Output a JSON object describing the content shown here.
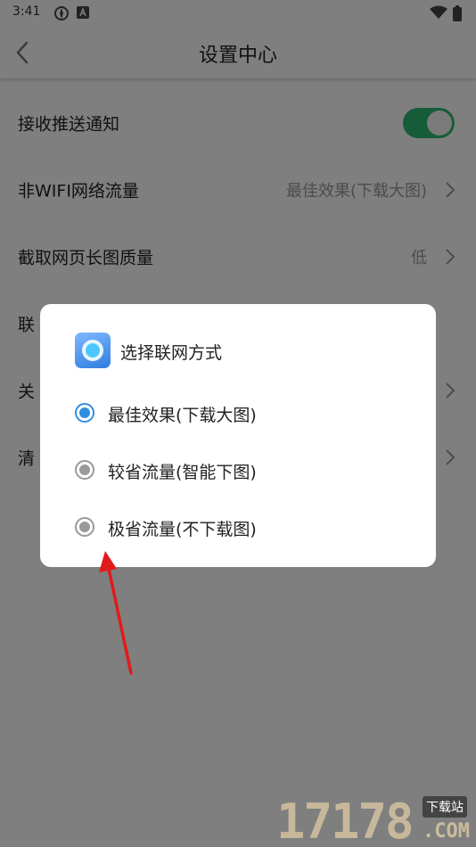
{
  "status_bar": {
    "time": "3:41"
  },
  "header": {
    "title": "设置中心"
  },
  "settings": [
    {
      "label": "接收推送通知",
      "type": "toggle",
      "on": true
    },
    {
      "label": "非WIFI网络流量",
      "value": "最佳效果(下载大图)",
      "type": "nav"
    },
    {
      "label": "截取网页长图质量",
      "value": "低",
      "type": "nav"
    },
    {
      "label": "联",
      "type": "text"
    },
    {
      "label": "关",
      "type": "nav"
    },
    {
      "label": "清",
      "type": "nav"
    }
  ],
  "dialog": {
    "title": "选择联网方式",
    "options": [
      {
        "label": "最佳效果(下载大图)",
        "checked": true
      },
      {
        "label": "较省流量(智能下图)",
        "checked": false
      },
      {
        "label": "极省流量(不下载图)",
        "checked": false
      }
    ]
  },
  "watermark": {
    "number": "17178",
    "tag": "下载站",
    "domain": ".COM"
  },
  "colors": {
    "toggle_on": "#2eb872",
    "radio_selected": "#2f8ee0",
    "radio_unselected": "#9a9a9a",
    "annotation_arrow": "#e11b1b"
  }
}
